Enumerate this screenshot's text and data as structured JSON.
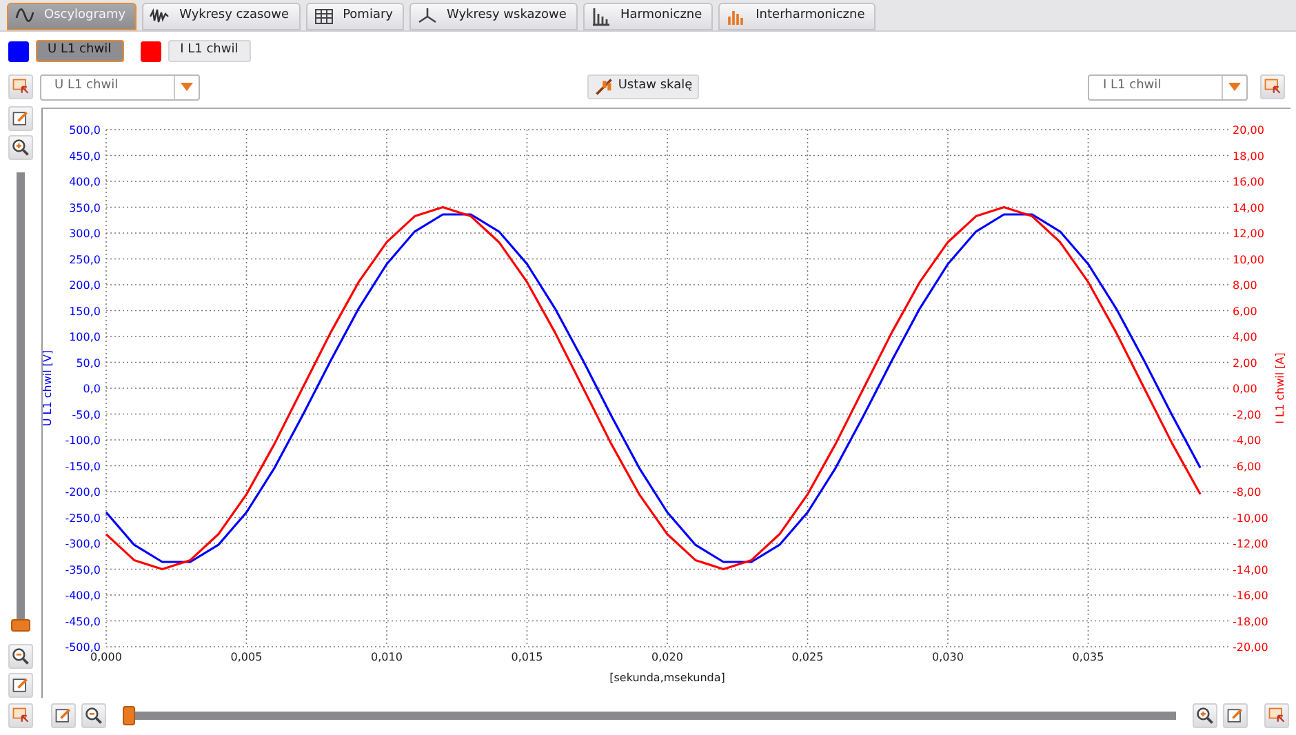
{
  "tabs": [
    {
      "label": "Oscylogramy",
      "kind": "wave",
      "selected": true
    },
    {
      "label": "Wykresy czasowe",
      "kind": "timeplot",
      "selected": false
    },
    {
      "label": "Pomiary",
      "kind": "table",
      "selected": false
    },
    {
      "label": "Wykresy wskazowe",
      "kind": "phasor",
      "selected": false
    },
    {
      "label": "Harmoniczne",
      "kind": "bars",
      "selected": false
    },
    {
      "label": "Interharmoniczne",
      "kind": "orangebars",
      "selected": false
    }
  ],
  "channels": [
    {
      "label": "U L1 chwil",
      "color": "#0000ff",
      "selected": true
    },
    {
      "label": "I L1 chwil",
      "color": "#ff0000",
      "selected": false
    }
  ],
  "toolbar": {
    "left_select": "U L1 chwil",
    "scale_button": "Ustaw skalę",
    "right_select": "I L1 chwil"
  },
  "vertical_slider": {
    "level": 0
  },
  "horizontal_slider": {
    "level": 0
  },
  "chart": {
    "chart_data": {
      "type": "line",
      "xlabel": "[sekunda,msekunda]",
      "ylabel": "U L1 chwil [V]",
      "y2label": "I L1 chwil [A]",
      "x": [
        0,
        0.001,
        0.002,
        0.003,
        0.004,
        0.005,
        0.006,
        0.007,
        0.008,
        0.009,
        0.01,
        0.011,
        0.012,
        0.013,
        0.014,
        0.015,
        0.016,
        0.017,
        0.018,
        0.019,
        0.02,
        0.021,
        0.022,
        0.023,
        0.024,
        0.025,
        0.026,
        0.027,
        0.028,
        0.029,
        0.03,
        0.031,
        0.032,
        0.033,
        0.034,
        0.035,
        0.036,
        0.037,
        0.038,
        0.039
      ],
      "series": [
        {
          "color": "#0000ff",
          "values": [
            -240,
            -303,
            -336,
            -336,
            -303,
            -240,
            -154,
            -53,
            53,
            154,
            240,
            303,
            336,
            336,
            303,
            240,
            154,
            53,
            -53,
            -154,
            -240,
            -303,
            -336,
            -336,
            -303,
            -240,
            -154,
            -53,
            53,
            154,
            240,
            303,
            336,
            336,
            303,
            240,
            154,
            53,
            -53,
            -154
          ]
        },
        {
          "color": "#ff0000",
          "axis": "y2",
          "values": [
            -11.3,
            -13.3,
            -14,
            -13.3,
            -11.3,
            -8.2,
            -4.3,
            0,
            4.3,
            8.2,
            11.3,
            13.3,
            14,
            13.3,
            11.3,
            8.2,
            4.3,
            0,
            -4.3,
            -8.2,
            -11.3,
            -13.3,
            -14,
            -13.3,
            -11.3,
            -8.2,
            -4.3,
            0,
            4.3,
            8.2,
            11.3,
            13.3,
            14,
            13.3,
            11.3,
            8.2,
            4.3,
            0,
            -4.3,
            -8.2
          ]
        }
      ],
      "grid": true,
      "xlim": [
        0,
        0.04
      ],
      "ylim": [
        -500,
        500
      ],
      "y2lim": [
        -20,
        20
      ],
      "xticks": [
        {
          "value": 0,
          "label": "0,000"
        },
        {
          "value": 0.005,
          "label": "0,005"
        },
        {
          "value": 0.01,
          "label": "0,010"
        },
        {
          "value": 0.015,
          "label": "0,015"
        },
        {
          "value": 0.02,
          "label": "0,020"
        },
        {
          "value": 0.025,
          "label": "0,025"
        },
        {
          "value": 0.03,
          "label": "0,030"
        },
        {
          "value": 0.035,
          "label": "0,035"
        }
      ],
      "yticks": [
        {
          "value": 500,
          "label": "500,0"
        },
        {
          "value": 450,
          "label": "450,0"
        },
        {
          "value": 400,
          "label": "400,0"
        },
        {
          "value": 350,
          "label": "350,0"
        },
        {
          "value": 300,
          "label": "300,0"
        },
        {
          "value": 250,
          "label": "250,0"
        },
        {
          "value": 200,
          "label": "200,0"
        },
        {
          "value": 150,
          "label": "150,0"
        },
        {
          "value": 100,
          "label": "100,0"
        },
        {
          "value": 50,
          "label": "50,0"
        },
        {
          "value": 0,
          "label": "0,0"
        },
        {
          "value": -50,
          "label": "-50,0"
        },
        {
          "value": -100,
          "label": "-100,0"
        },
        {
          "value": -150,
          "label": "-150,0"
        },
        {
          "value": -200,
          "label": "-200,0"
        },
        {
          "value": -250,
          "label": "-250,0"
        },
        {
          "value": -300,
          "label": "-300,0"
        },
        {
          "value": -350,
          "label": "-350,0"
        },
        {
          "value": -400,
          "label": "-400,0"
        },
        {
          "value": -450,
          "label": "-450,0"
        },
        {
          "value": -500,
          "label": "-500,0"
        }
      ],
      "y2ticks": [
        {
          "value": 20,
          "label": "20,00"
        },
        {
          "value": 18,
          "label": "18,00"
        },
        {
          "value": 16,
          "label": "16,00"
        },
        {
          "value": 14,
          "label": "14,00"
        },
        {
          "value": 12,
          "label": "12,00"
        },
        {
          "value": 10,
          "label": "10,00"
        },
        {
          "value": 8,
          "label": "8,00"
        },
        {
          "value": 6,
          "label": "6,00"
        },
        {
          "value": 4,
          "label": "4,00"
        },
        {
          "value": 2,
          "label": "2,00"
        },
        {
          "value": 0,
          "label": "0,00"
        },
        {
          "value": -2,
          "label": "-2,00"
        },
        {
          "value": -4,
          "label": "-4,00"
        },
        {
          "value": -6,
          "label": "-6,00"
        },
        {
          "value": -8,
          "label": "-8,00"
        },
        {
          "value": -10,
          "label": "-10,00"
        },
        {
          "value": -12,
          "label": "-12,00"
        },
        {
          "value": -14,
          "label": "-14,00"
        },
        {
          "value": -16,
          "label": "-16,00"
        },
        {
          "value": -18,
          "label": "-18,00"
        },
        {
          "value": -20,
          "label": "-20,00"
        }
      ]
    }
  }
}
